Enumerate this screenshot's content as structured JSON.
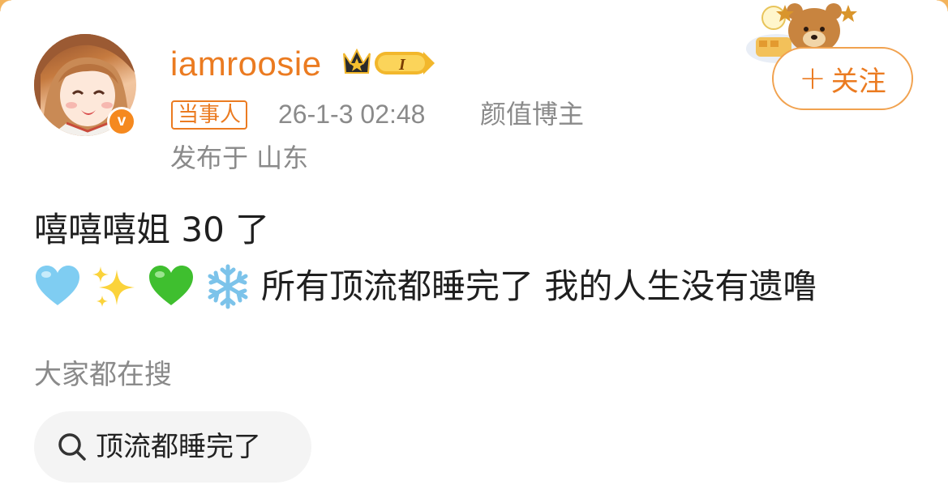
{
  "user": {
    "name": "iamroosie",
    "verified_mark": "v",
    "level_badge": "I",
    "tag": "当事人",
    "timestamp": "26-1-3 02:48",
    "role": "颜值博主",
    "location": "发布于 山东"
  },
  "follow_button": {
    "plus": "+",
    "label": "关注"
  },
  "post": {
    "line1": "嘻嘻嘻姐 30 了",
    "line2_emojis": [
      "light-blue-heart-icon",
      "sparkles-icon",
      "green-heart-icon",
      "snowflake-icon"
    ],
    "line2_text": "所有顶流都睡完了 我的人生没有遗噜"
  },
  "search": {
    "heading": "大家都在搜",
    "chip_label": "顶流都睡完了"
  },
  "colors": {
    "accent": "#eb7b21",
    "meta_gray": "#8a8a8a",
    "chip_bg": "#f4f4f4"
  }
}
